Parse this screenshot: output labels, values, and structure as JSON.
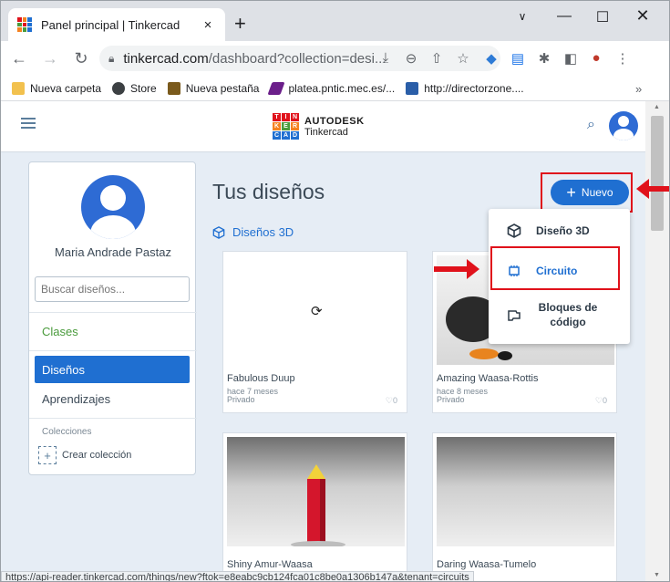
{
  "browser": {
    "tab_title": "Panel principal | Tinkercad",
    "tab_close": "×",
    "new_tab": "+",
    "url_host": "tinkercad.com",
    "url_path": "/dashboard?collection=desi...",
    "bookmarks": [
      {
        "label": "Nueva carpeta",
        "icon": "folder-icon",
        "color": "#f2c14e"
      },
      {
        "label": "Store",
        "icon": "store-icon",
        "color": "#3c4043"
      },
      {
        "label": "Nueva pestaña",
        "icon": "newtab-icon",
        "color": "#7a5a1c"
      },
      {
        "label": "platea.pntic.mec.es/...",
        "icon": "platea-icon",
        "color": "#6b1f8a"
      },
      {
        "label": "http://directorzone....",
        "icon": "dz-icon",
        "color": "#2a5ea8"
      }
    ],
    "bookmarks_more": "»",
    "status_url": "https://api-reader.tinkercad.com/things/new?ftok=e8eabc9cb124fca01c8be0a1306b147a&tenant=circuits"
  },
  "app": {
    "brand_top": "AUTODESK",
    "brand_bottom": "Tinkercad",
    "logo_letters": [
      "T",
      "I",
      "N",
      "K",
      "E",
      "R",
      "C",
      "A",
      "D"
    ],
    "user_name": "Maria Andrade Pastaz",
    "search_placeholder": "Buscar diseños...",
    "nav": {
      "clases": "Clases",
      "disenos": "Diseños",
      "aprendizajes": "Aprendizajes",
      "colecciones": "Colecciones",
      "crear_coleccion": "Crear colección"
    },
    "page_title": "Tus diseños",
    "section_label": "Diseños 3D",
    "new_button": "Nuevo",
    "menu": {
      "diseno3d": "Diseño 3D",
      "circuito": "Circuito",
      "bloques_line1": "Bloques de",
      "bloques_line2": "código"
    },
    "cards": [
      {
        "title": "Fabulous Duup",
        "time": "hace 7 meses",
        "privacy": "Privado",
        "likes": "♡0"
      },
      {
        "title": "Amazing Waasa-Rottis",
        "time": "hace 8 meses",
        "privacy": "Privado",
        "likes": "♡0"
      },
      {
        "title": "Shiny Amur-Waasa",
        "time": "",
        "privacy": "",
        "likes": ""
      },
      {
        "title": "Daring Waasa-Tumelo",
        "time": "",
        "privacy": "",
        "likes": ""
      }
    ]
  },
  "colors": {
    "accent": "#1f6fd1",
    "highlight": "#e0121b",
    "green": "#4a9b3c"
  }
}
